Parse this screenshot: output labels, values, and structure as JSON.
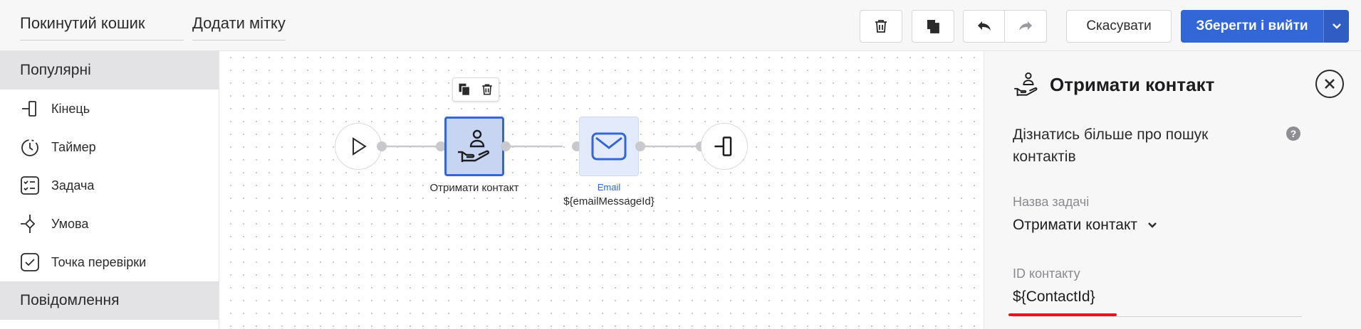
{
  "toolbar": {
    "flow_name": "Покинутий кошик",
    "add_tag": "Додати мітку",
    "cancel_label": "Скасувати",
    "save_label": "Зберегти і вийти",
    "icons": [
      "trash-icon",
      "copy-icon",
      "undo-icon",
      "redo-icon",
      "chevron-down-icon"
    ]
  },
  "sidebar": {
    "popular_header": "Популярні",
    "items": [
      {
        "label": "Кінець",
        "icon": "end-icon"
      },
      {
        "label": "Таймер",
        "icon": "timer-icon"
      },
      {
        "label": "Задача",
        "icon": "task-icon"
      },
      {
        "label": "Умова",
        "icon": "condition-icon"
      },
      {
        "label": "Точка перевірки",
        "icon": "checkpoint-icon"
      }
    ],
    "messages_header": "Повідомлення"
  },
  "canvas": {
    "nodes": [
      {
        "type": "start",
        "icon": "play-icon"
      },
      {
        "type": "task",
        "label": "Отримати контакт",
        "icon": "hand-person-icon",
        "selected": true
      },
      {
        "type": "email",
        "sublabel": "Email",
        "label": "${emailMessageId}",
        "icon": "envelope-icon"
      },
      {
        "type": "end",
        "icon": "end-icon"
      }
    ],
    "accent": "#3366d6"
  },
  "panel": {
    "title": "Отримати контакт",
    "learn_more": "Дізнатись більше про пошук контактів",
    "task_name_label": "Назва задачі",
    "task_name_value": "Отримати контакт",
    "contact_id_label": "ID контакту",
    "contact_id_value": "${ContactId}"
  }
}
